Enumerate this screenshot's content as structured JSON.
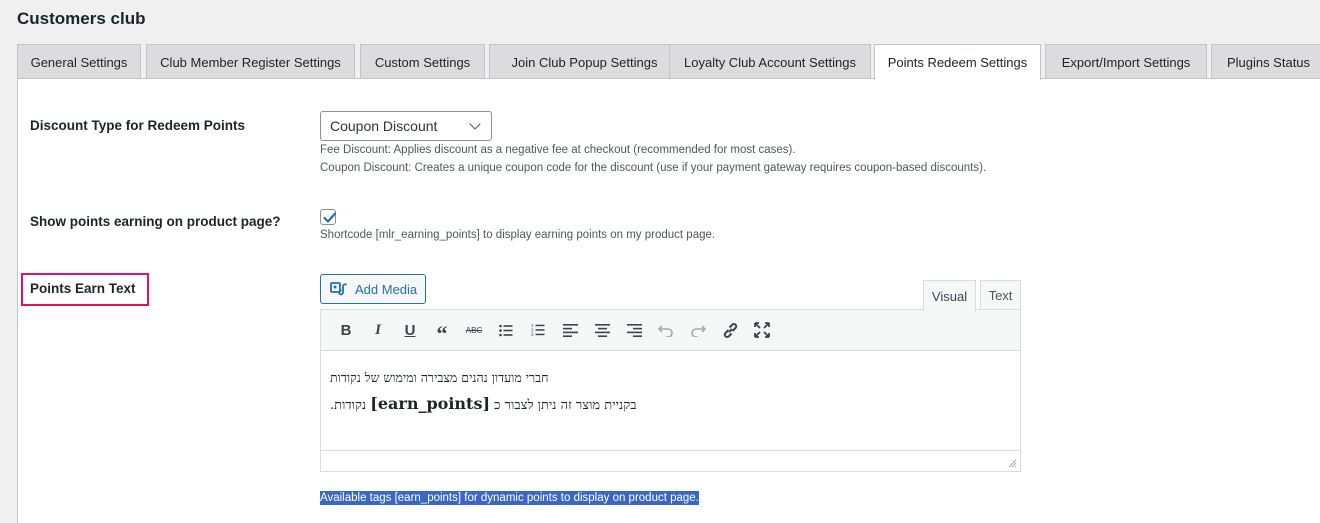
{
  "page": {
    "title": "Customers club"
  },
  "tabs": [
    {
      "label": "General Settings",
      "active": false
    },
    {
      "label": "Club Member Register Settings",
      "active": false
    },
    {
      "label": "Custom Settings",
      "active": false
    },
    {
      "label": "Join Club Popup Settings",
      "active": false
    },
    {
      "label": "Loyalty Club Account Settings",
      "active": false
    },
    {
      "label": "Points Redeem Settings",
      "active": true
    },
    {
      "label": "Export/Import Settings",
      "active": false
    },
    {
      "label": "Plugins Status",
      "active": false
    }
  ],
  "discount_type": {
    "label": "Discount Type for Redeem Points",
    "selected": "Coupon Discount",
    "desc1": "Fee Discount: Applies discount as a negative fee at checkout (recommended for most cases).",
    "desc2": "Coupon Discount: Creates a unique coupon code for the discount (use if your payment gateway requires coupon-based discounts)."
  },
  "show_points": {
    "label": "Show points earning on product page?",
    "checked": true,
    "desc": "Shortcode [mlr_earning_points] to display earning points on my product page."
  },
  "earn_text": {
    "label": "Points Earn Text",
    "add_media": "Add Media",
    "mode_visual": "Visual",
    "mode_text": "Text",
    "line1": "חברי מועדון נהנים מצבירה ומימוש של נקודות",
    "line2_pre": "בקניית מוצר זה ניתן לצבור כ",
    "line2_tag": "[earn_points]",
    "line2_post": "נקודות.",
    "note": "Available tags [earn_points] for dynamic points to display on product page."
  },
  "toolbar_icons": [
    "bold-icon",
    "italic-icon",
    "underline-icon",
    "blockquote-icon",
    "strikethrough-icon",
    "bullet-list-icon",
    "numbered-list-icon",
    "align-left-icon",
    "align-center-icon",
    "align-right-icon",
    "undo-icon",
    "redo-icon",
    "link-icon",
    "fullscreen-icon"
  ],
  "colors": {
    "accent": "#2271b1",
    "highlight": "#e5105e",
    "selection": "#3a66c4"
  }
}
